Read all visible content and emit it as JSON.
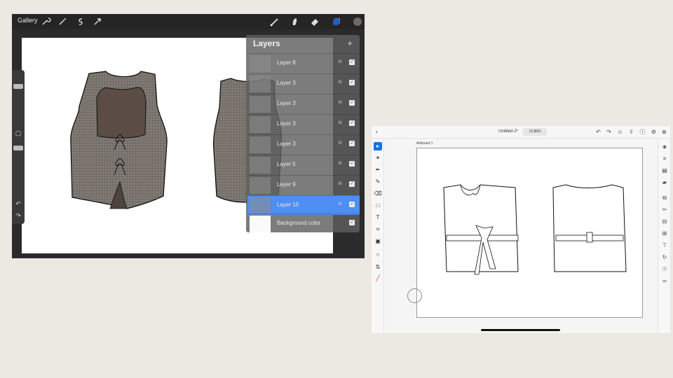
{
  "procreate": {
    "gallery_label": "Gallery",
    "tools_left": [
      "wrench-icon",
      "magic-wand-icon",
      "selection-icon",
      "transform-icon"
    ],
    "tools_right": [
      "brush-icon",
      "smudge-icon",
      "eraser-icon",
      "layers-icon",
      "color-icon"
    ],
    "accent": "#4f8ef2",
    "layers_panel": {
      "title": "Layers",
      "add_icon": "plus-icon",
      "layers": [
        {
          "name": "Layer 8",
          "mode": "N",
          "visible": true,
          "active": false
        },
        {
          "name": "Layer 3",
          "mode": "N",
          "visible": true,
          "active": false
        },
        {
          "name": "Layer 3",
          "mode": "N",
          "visible": true,
          "active": false
        },
        {
          "name": "Layer 3",
          "mode": "N",
          "visible": true,
          "active": false
        },
        {
          "name": "Layer 3",
          "mode": "N",
          "visible": true,
          "active": false
        },
        {
          "name": "Layer 5",
          "mode": "N",
          "visible": true,
          "active": false
        },
        {
          "name": "Layer 9",
          "mode": "N",
          "visible": true,
          "active": false
        },
        {
          "name": "Layer 10",
          "mode": "N",
          "visible": true,
          "active": true
        }
      ],
      "background": {
        "name": "Background color",
        "visible": true
      }
    }
  },
  "illustrator": {
    "doc_name": "Untitled-2*",
    "zoom": "13,86%",
    "artboard_label": "Artboard 1",
    "accent": "#1473e6"
  }
}
